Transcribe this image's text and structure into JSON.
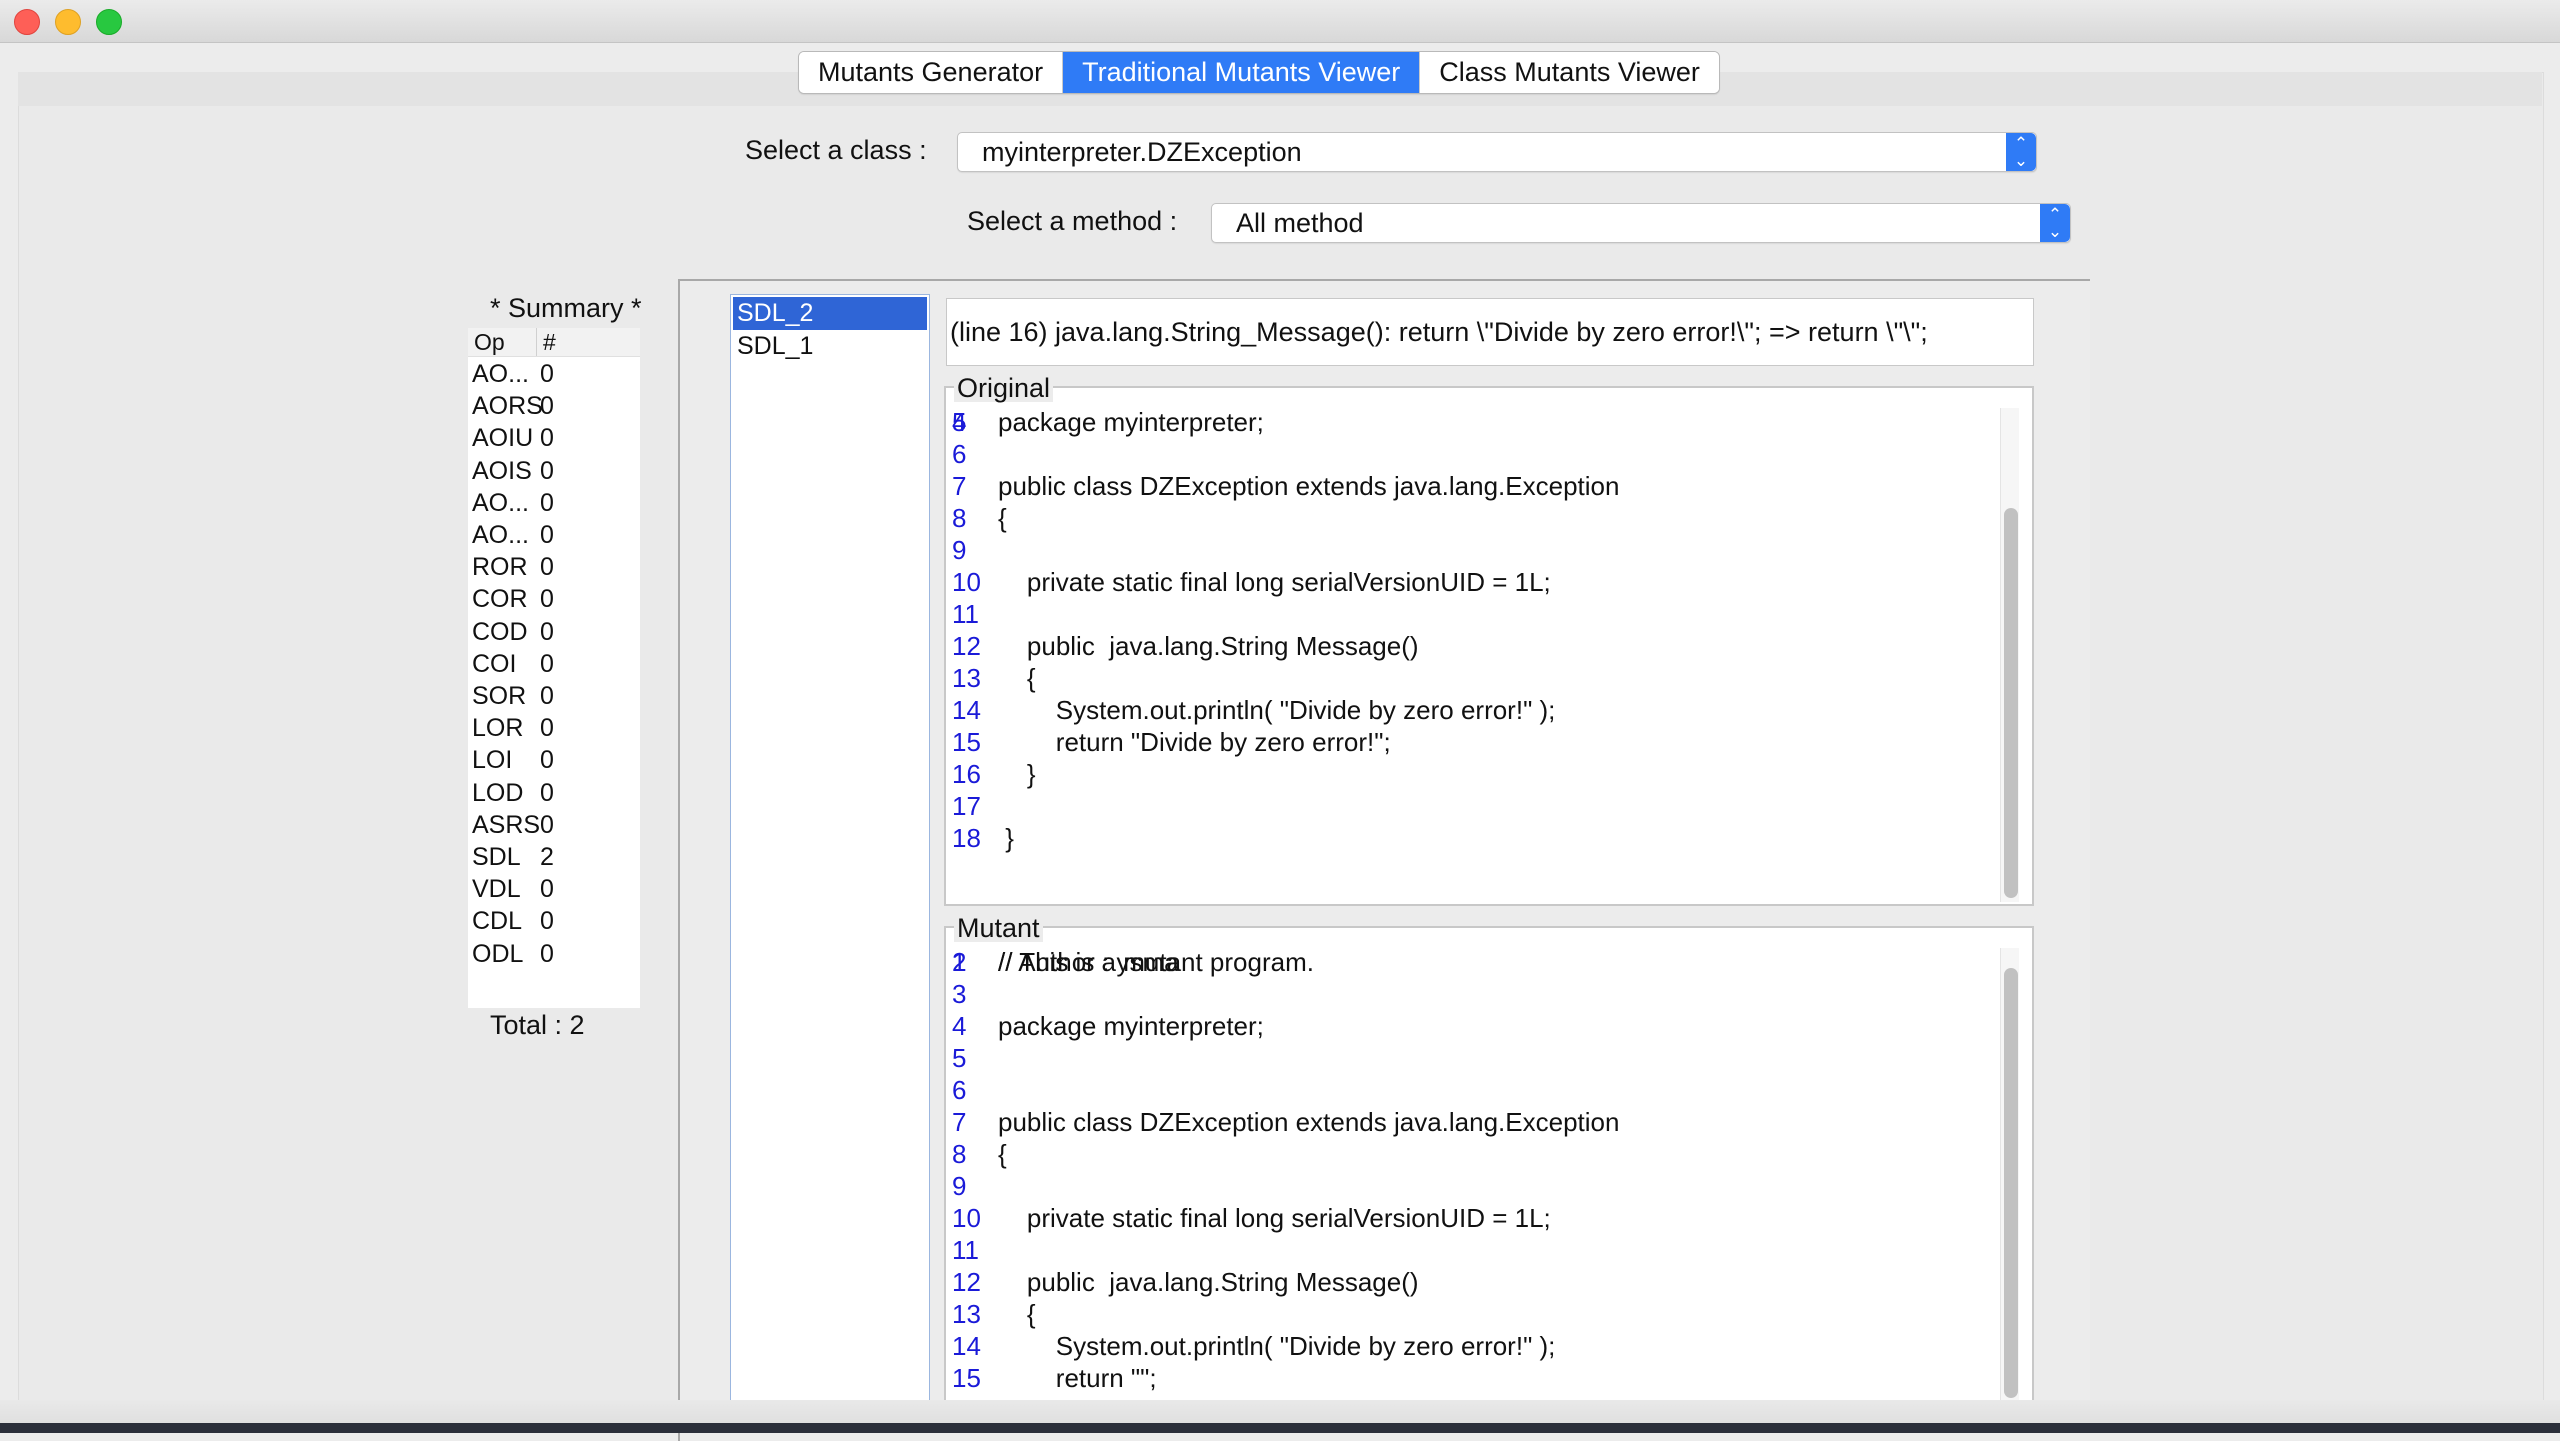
{
  "tabs": [
    {
      "label": "Mutants Generator",
      "active": false
    },
    {
      "label": "Traditional Mutants Viewer",
      "active": true
    },
    {
      "label": "Class Mutants Viewer",
      "active": false
    }
  ],
  "class_select": {
    "label": "Select a class :",
    "value": "myinterpreter.DZException"
  },
  "method_select": {
    "label": "Select a method :",
    "value": "All method"
  },
  "summary": {
    "title": "* Summary *",
    "col_op": "Op",
    "col_count": "#",
    "rows": [
      {
        "op": "AO...",
        "count": "0"
      },
      {
        "op": "AORS",
        "count": "0"
      },
      {
        "op": "AOIU",
        "count": "0"
      },
      {
        "op": "AOIS",
        "count": "0"
      },
      {
        "op": "AO...",
        "count": "0"
      },
      {
        "op": "AO...",
        "count": "0"
      },
      {
        "op": "ROR",
        "count": "0"
      },
      {
        "op": "COR",
        "count": "0"
      },
      {
        "op": "COD",
        "count": "0"
      },
      {
        "op": "COI",
        "count": "0"
      },
      {
        "op": "SOR",
        "count": "0"
      },
      {
        "op": "LOR",
        "count": "0"
      },
      {
        "op": "LOI",
        "count": "0"
      },
      {
        "op": "LOD",
        "count": "0"
      },
      {
        "op": "ASRS",
        "count": "0"
      },
      {
        "op": "SDL",
        "count": "2"
      },
      {
        "op": "VDL",
        "count": "0"
      },
      {
        "op": "CDL",
        "count": "0"
      },
      {
        "op": "ODL",
        "count": "0"
      }
    ],
    "total": "Total : 2"
  },
  "mutant_list": [
    {
      "label": "SDL_2",
      "selected": true
    },
    {
      "label": "SDL_1",
      "selected": false
    }
  ],
  "change_description": "(line 16) java.lang.String_Message(): return \\\"Divide by zero error!\\\";  =>   return \\\"\\\";",
  "original": {
    "legend": "Original",
    "partial_first_line": {
      "num": "4",
      "text": "package myinterpreter;"
    },
    "lines": [
      {
        "num": "5",
        "text": ""
      },
      {
        "num": "6",
        "text": ""
      },
      {
        "num": "7",
        "text": "public class DZException extends java.lang.Exception"
      },
      {
        "num": "8",
        "text": "{"
      },
      {
        "num": "9",
        "text": ""
      },
      {
        "num": "10",
        "text": "    private static final long serialVersionUID = 1L;"
      },
      {
        "num": "11",
        "text": ""
      },
      {
        "num": "12",
        "text": "    public  java.lang.String Message()"
      },
      {
        "num": "13",
        "text": "    {"
      },
      {
        "num": "14",
        "text": "        System.out.println( \"Divide by zero error!\" );"
      },
      {
        "num": "15",
        "text": "        return \"Divide by zero error!\";"
      },
      {
        "num": "16",
        "text": "    }"
      },
      {
        "num": "17",
        "text": ""
      },
      {
        "num": "18",
        "text": " }"
      }
    ]
  },
  "mutant": {
    "legend": "Mutant",
    "partial_first_line": {
      "num": "1",
      "text": "// This is a mutant program."
    },
    "lines": [
      {
        "num": "2",
        "text": "// Author : ysma"
      },
      {
        "num": "3",
        "text": ""
      },
      {
        "num": "4",
        "text": "package myinterpreter;"
      },
      {
        "num": "5",
        "text": ""
      },
      {
        "num": "6",
        "text": ""
      },
      {
        "num": "7",
        "text": "public class DZException extends java.lang.Exception"
      },
      {
        "num": "8",
        "text": "{"
      },
      {
        "num": "9",
        "text": ""
      },
      {
        "num": "10",
        "text": "    private static final long serialVersionUID = 1L;"
      },
      {
        "num": "11",
        "text": ""
      },
      {
        "num": "12",
        "text": "    public  java.lang.String Message()"
      },
      {
        "num": "13",
        "text": "    {"
      },
      {
        "num": "14",
        "text": "        System.out.println( \"Divide by zero error!\" );"
      },
      {
        "num": "15",
        "text": "        return \"\";"
      }
    ]
  },
  "colors": {
    "accent": "#2f7bf6",
    "selection": "#2f65d6",
    "line_number": "#1a1ad8"
  }
}
